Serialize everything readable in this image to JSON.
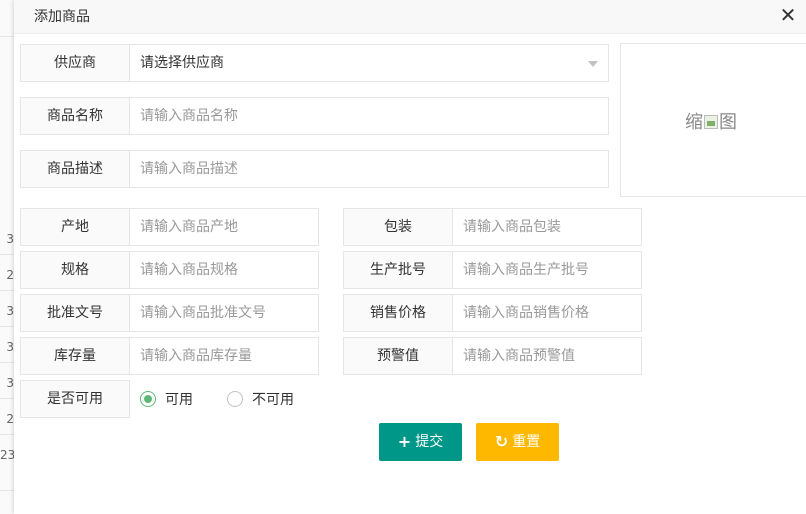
{
  "background": {
    "row_fragments": [
      "3",
      "2",
      "3",
      "3",
      "3",
      "2",
      "23"
    ]
  },
  "dialog": {
    "title": "添加商品",
    "close_icon": "close-icon"
  },
  "form": {
    "supplier": {
      "label": "供应商",
      "value": "请选择供应商"
    },
    "name": {
      "label": "商品名称",
      "placeholder": "请输入商品名称"
    },
    "description": {
      "label": "商品描述",
      "placeholder": "请输入商品描述"
    },
    "origin": {
      "label": "产地",
      "placeholder": "请输入商品产地"
    },
    "packaging": {
      "label": "包装",
      "placeholder": "请输入商品包装"
    },
    "spec": {
      "label": "规格",
      "placeholder": "请输入商品规格"
    },
    "batch_no": {
      "label": "生产批号",
      "placeholder": "请输入商品生产批号"
    },
    "approval_no": {
      "label": "批准文号",
      "placeholder": "请输入商品批准文号"
    },
    "sale_price": {
      "label": "销售价格",
      "placeholder": "请输入商品销售价格"
    },
    "stock": {
      "label": "库存量",
      "placeholder": "请输入商品库存量"
    },
    "alert_value": {
      "label": "预警值",
      "placeholder": "请输入商品预警值"
    },
    "available": {
      "label": "是否可用",
      "options": [
        "可用",
        "不可用"
      ],
      "selected": "可用"
    }
  },
  "thumbnail": {
    "text_before": "缩",
    "text_after": "图"
  },
  "buttons": {
    "submit_icon": "plus-icon",
    "submit_label": "提交",
    "reset_icon": "refresh-icon",
    "reset_label": "重置"
  },
  "colors": {
    "submit": "#009688",
    "reset": "#FFB800",
    "radio_checked": "#5FB878"
  }
}
